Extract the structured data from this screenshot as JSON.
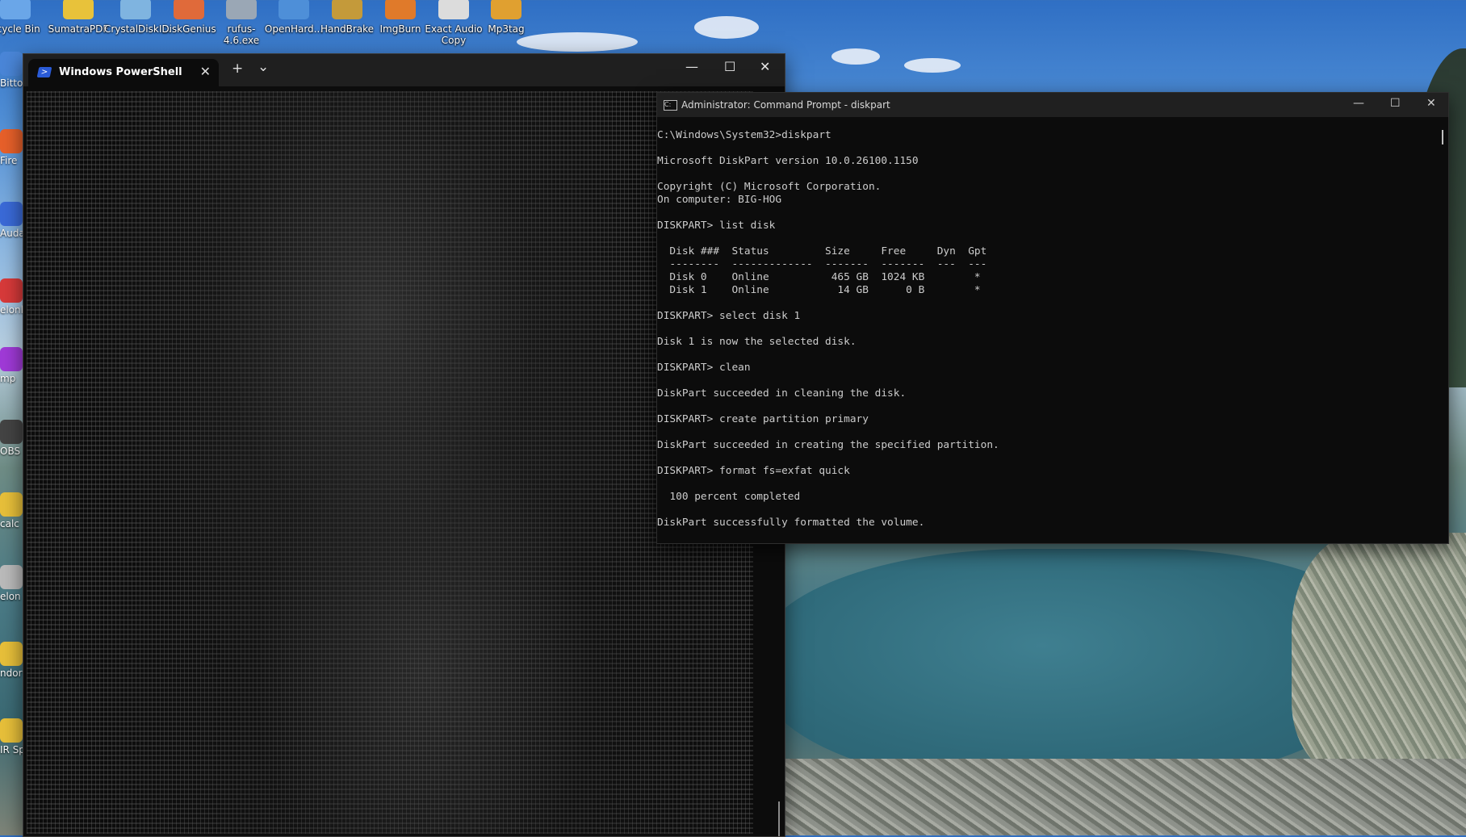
{
  "desktop": {
    "top_icons": [
      {
        "label": "ecycle Bin",
        "icon": "recycle-bin-icon"
      },
      {
        "label": "SumatraPDF",
        "icon": "pdf-icon"
      },
      {
        "label": "CrystalDiskI...",
        "icon": "disk-info-icon"
      },
      {
        "label": "DiskGenius",
        "icon": "diskgenius-icon"
      },
      {
        "label": "rufus-4.6.exe",
        "icon": "usb-icon"
      },
      {
        "label": "OpenHard...",
        "icon": "hardware-monitor-icon"
      },
      {
        "label": "HandBrake",
        "icon": "pineapple-icon"
      },
      {
        "label": "ImgBurn",
        "icon": "disc-fire-icon"
      },
      {
        "label": "Exact Audio Copy",
        "icon": "eac-icon"
      },
      {
        "label": "Mp3tag",
        "icon": "tag-icon"
      }
    ],
    "side_icons": [
      {
        "label": "Bitto",
        "icon": "app-icon"
      },
      {
        "label": "Fire",
        "icon": "firefox-icon"
      },
      {
        "label": "Auda",
        "icon": "audacity-icon"
      },
      {
        "label": "elonl",
        "icon": "app-icon"
      },
      {
        "label": "mp",
        "icon": "media-icon"
      },
      {
        "label": "OBS S",
        "icon": "obs-icon"
      },
      {
        "label": "calc",
        "icon": "folder-icon"
      },
      {
        "label": "elon",
        "icon": "gear-icon"
      },
      {
        "label": "ndor PD",
        "icon": "folder-icon"
      },
      {
        "label": "IR Sp",
        "icon": "folder-icon"
      }
    ]
  },
  "powershell": {
    "tab_title": "Windows PowerShell",
    "tab_close": "✕",
    "new_tab": "+",
    "dropdown": "⌄",
    "minimize": "—",
    "maximize": "☐",
    "close": "✕"
  },
  "cmd": {
    "title": "Administrator: Command Prompt - diskpart",
    "minimize": "—",
    "maximize": "☐",
    "close": "✕",
    "lines": [
      "C:\\Windows\\System32>diskpart",
      "",
      "Microsoft DiskPart version 10.0.26100.1150",
      "",
      "Copyright (C) Microsoft Corporation.",
      "On computer: BIG-HOG",
      "",
      "DISKPART> list disk",
      "",
      "  Disk ###  Status         Size     Free     Dyn  Gpt",
      "  --------  -------------  -------  -------  ---  ---",
      "  Disk 0    Online          465 GB  1024 KB        *",
      "  Disk 1    Online           14 GB      0 B        *",
      "",
      "DISKPART> select disk 1",
      "",
      "Disk 1 is now the selected disk.",
      "",
      "DISKPART> clean",
      "",
      "DiskPart succeeded in cleaning the disk.",
      "",
      "DISKPART> create partition primary",
      "",
      "DiskPart succeeded in creating the specified partition.",
      "",
      "DISKPART> format fs=exfat quick",
      "",
      "  100 percent completed",
      "",
      "DiskPart successfully formatted the volume."
    ]
  }
}
